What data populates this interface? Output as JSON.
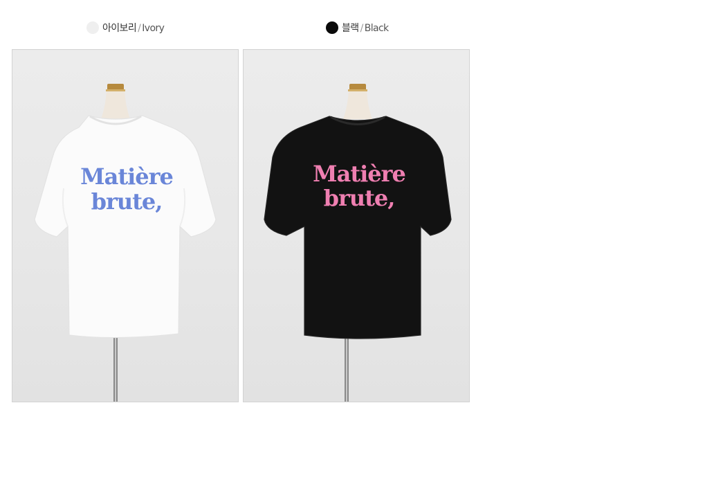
{
  "colors": [
    {
      "key": "ivory",
      "korean": "아이보리",
      "separator": "/",
      "english": "Ivory",
      "swatch_hex": "#efefef",
      "shirt_hex": "#fbfbfb",
      "print_hex": "#6a86d8",
      "print_lines": [
        "Matière",
        "brute,"
      ]
    },
    {
      "key": "black",
      "korean": "블랙",
      "separator": "/",
      "english": "Black",
      "swatch_hex": "#0a0a0a",
      "shirt_hex": "#121212",
      "print_hex": "#ef7fb1",
      "print_lines": [
        "Matière",
        "brute,"
      ]
    }
  ]
}
